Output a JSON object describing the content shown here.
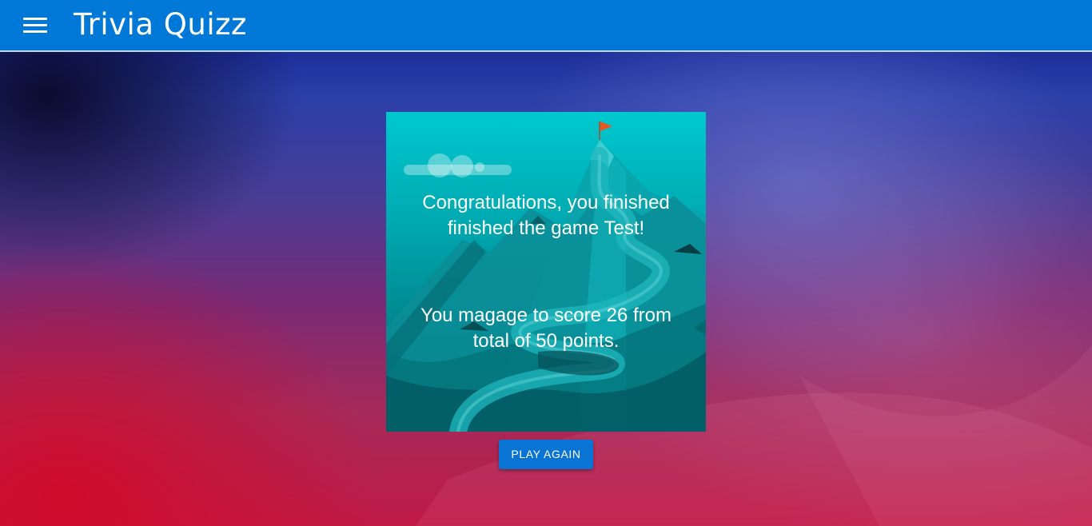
{
  "app": {
    "title": "Trivia Quizz",
    "menu_icon": "hamburger-menu-icon",
    "bar_color": "#0078d7"
  },
  "result": {
    "congrats_text": "Congratulations, you finished finished the game Test!",
    "score_text": "You magage to score 26 from total of 50 points.",
    "score": 26,
    "total": 50,
    "game_name": "Test",
    "illustration": "mountain-flag-illustration"
  },
  "actions": {
    "play_again_label": "PLAY AGAIN",
    "button_color": "#0a74d4"
  }
}
